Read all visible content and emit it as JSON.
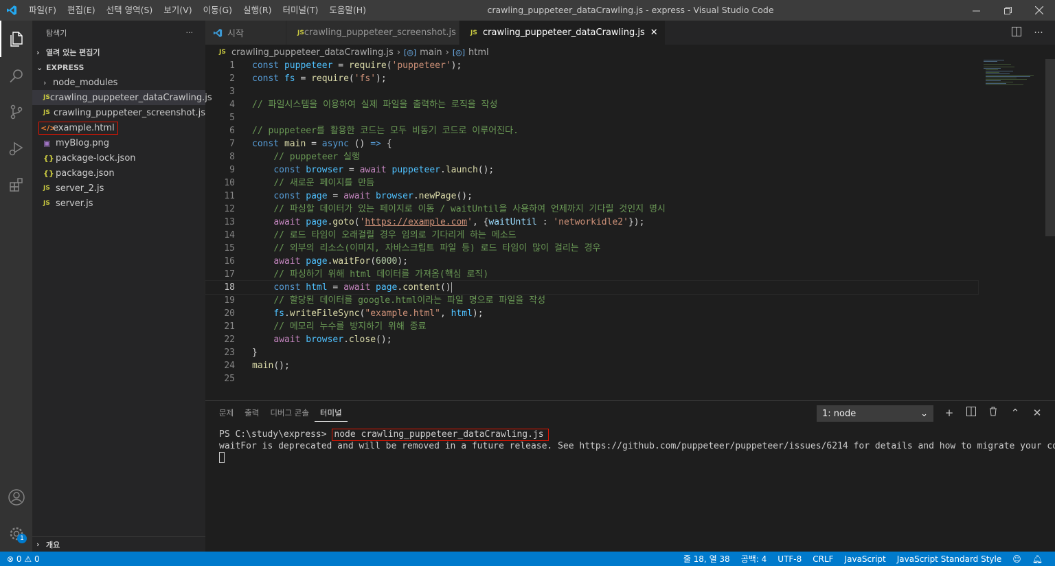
{
  "window": {
    "title": "crawling_puppeteer_dataCrawling.js - express - Visual Studio Code",
    "menu": [
      "파일(F)",
      "편집(E)",
      "선택 영역(S)",
      "보기(V)",
      "이동(G)",
      "실행(R)",
      "터미널(T)",
      "도움말(H)"
    ]
  },
  "sidebar": {
    "title": "탐색기",
    "more": "···",
    "open_editors": "열려 있는 편집기",
    "folder": "EXPRESS",
    "items": [
      {
        "name": "node_modules",
        "icon": "folder"
      },
      {
        "name": "crawling_puppeteer_dataCrawling.js",
        "icon": "JS"
      },
      {
        "name": "crawling_puppeteer_screenshot.js",
        "icon": "JS"
      },
      {
        "name": "example.html",
        "icon": "html"
      },
      {
        "name": "myBlog.png",
        "icon": "png"
      },
      {
        "name": "package-lock.json",
        "icon": "{}"
      },
      {
        "name": "package.json",
        "icon": "{}"
      },
      {
        "name": "server_2.js",
        "icon": "JS"
      },
      {
        "name": "server.js",
        "icon": "JS"
      }
    ],
    "outline": "개요"
  },
  "tabs": [
    {
      "label": "시작",
      "icon": "vscode"
    },
    {
      "label": "crawling_puppeteer_screenshot.js",
      "icon": "JS"
    },
    {
      "label": "crawling_puppeteer_dataCrawling.js",
      "icon": "JS",
      "close": "✕"
    }
  ],
  "breadcrumb": {
    "file": "crawling_puppeteer_dataCrawling.js",
    "sym1": "main",
    "sym2": "html"
  },
  "editor": {
    "line_numbers": [
      "1",
      "2",
      "3",
      "4",
      "5",
      "6",
      "7",
      "8",
      "9",
      "10",
      "11",
      "12",
      "13",
      "14",
      "15",
      "16",
      "17",
      "18",
      "19",
      "20",
      "21",
      "22",
      "23",
      "24",
      "25"
    ]
  },
  "panel": {
    "tabs": [
      "문제",
      "출력",
      "디버그 콘솔",
      "터미널"
    ],
    "terminal_select": "1: node",
    "prompt": "PS C:\\study\\express> ",
    "command": "node crawling_puppeteer_dataCrawling.js",
    "output": "waitFor is deprecated and will be removed in a future release. See https://github.com/puppeteer/puppeteer/issues/6214 for details and how to migrate your code."
  },
  "status": {
    "errors": "0",
    "warnings": "0",
    "position": "줄 18, 열 38",
    "indent": "공백: 4",
    "encoding": "UTF-8",
    "eol": "CRLF",
    "language": "JavaScript",
    "formatter": "JavaScript Standard Style"
  },
  "colors": {
    "accent": "#007acc",
    "highlight": "#e51400"
  }
}
